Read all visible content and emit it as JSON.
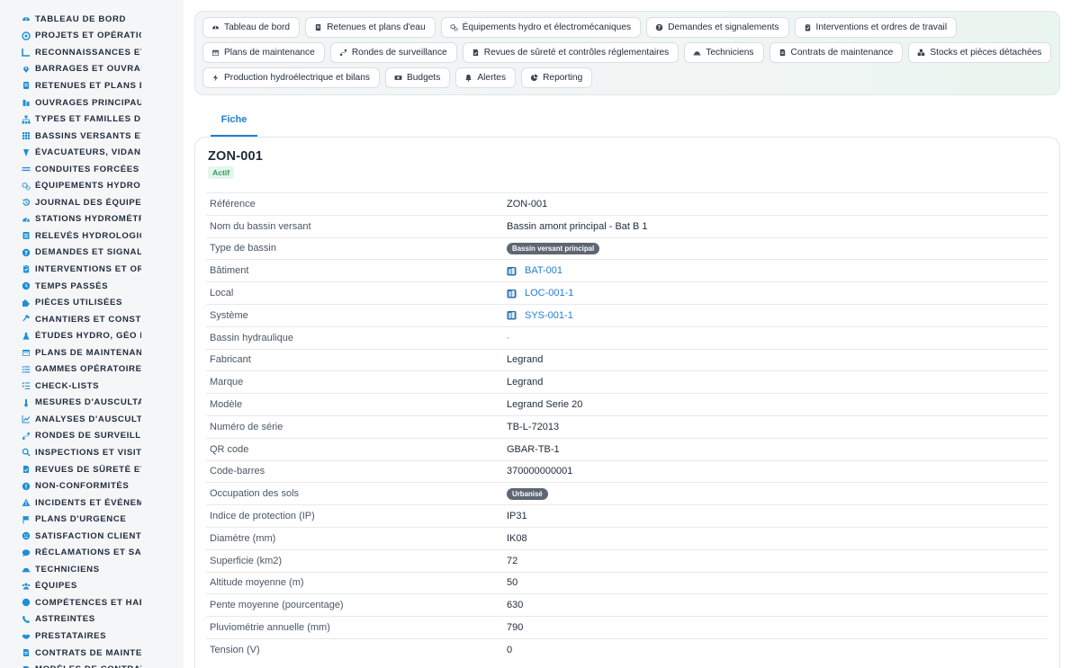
{
  "sidebar": {
    "items": [
      {
        "label": "TABLEAU DE BORD",
        "icon": "dashboard-icon"
      },
      {
        "label": "PROJETS ET OPÉRATION",
        "icon": "target-icon"
      },
      {
        "label": "RECONNAISSANCES ET V",
        "icon": "ruler-icon"
      },
      {
        "label": "BARRAGES ET OUVRAGE",
        "icon": "pin-icon"
      },
      {
        "label": "RETENUES ET PLANS D'E",
        "icon": "document-icon"
      },
      {
        "label": "OUVRAGES PRINCIPAUX",
        "icon": "building-icon"
      },
      {
        "label": "TYPES ET FAMILLES D'OU",
        "icon": "hierarchy-icon"
      },
      {
        "label": "BASSINS VERSANTS ET A",
        "icon": "grid-icon"
      },
      {
        "label": "ÉVACUATEURS, VIDANGE",
        "icon": "spillway-icon"
      },
      {
        "label": "CONDUITES FORCÉES ET",
        "icon": "pipe-icon"
      },
      {
        "label": "ÉQUIPEMENTS HYDRO ET",
        "icon": "cogs-icon"
      },
      {
        "label": "JOURNAL DES ÉQUIPEME",
        "icon": "history-icon"
      },
      {
        "label": "STATIONS HYDROMÉTRIC",
        "icon": "gauge-icon"
      },
      {
        "label": "RELEVÉS HYDROLOGIQU",
        "icon": "list-icon"
      },
      {
        "label": "DEMANDES ET SIGNALEM",
        "icon": "question-icon"
      },
      {
        "label": "INTERVENTIONS ET ORDI",
        "icon": "clipboard-icon"
      },
      {
        "label": "TEMPS PASSÉS",
        "icon": "clock-icon"
      },
      {
        "label": "PIÈCES UTILISÉES",
        "icon": "puzzle-icon"
      },
      {
        "label": "CHANTIERS ET CONSTRU",
        "icon": "hammer-icon"
      },
      {
        "label": "ÉTUDES HYDRO, GÉO ET",
        "icon": "flask-icon"
      },
      {
        "label": "PLANS DE MAINTENANCE",
        "icon": "calendar-icon"
      },
      {
        "label": "GAMMES OPÉRATOIRES",
        "icon": "bullet-list-icon"
      },
      {
        "label": "CHECK-LISTS",
        "icon": "checklist-icon"
      },
      {
        "label": "MESURES D'AUSCULTATI",
        "icon": "thermometer-icon"
      },
      {
        "label": "ANALYSES D'AUSCULTAT",
        "icon": "chart-line-icon"
      },
      {
        "label": "RONDES DE SURVEILLAN",
        "icon": "route-icon"
      },
      {
        "label": "INSPECTIONS ET VISITES",
        "icon": "search-icon"
      },
      {
        "label": "REVUES DE SÛRETÉ ET C",
        "icon": "file-check-icon"
      },
      {
        "label": "NON-CONFORMITÉS",
        "icon": "alert-circle-icon"
      },
      {
        "label": "INCIDENTS ET ÉVÉNEMEI",
        "icon": "warning-icon"
      },
      {
        "label": "PLANS D'URGENCE",
        "icon": "flag-icon"
      },
      {
        "label": "SATISFACTION CLIENT",
        "icon": "smile-icon"
      },
      {
        "label": "RÉCLAMATIONS ET SAV",
        "icon": "comment-icon"
      },
      {
        "label": "TECHNICIENS",
        "icon": "hardhat-icon"
      },
      {
        "label": "ÉQUIPES",
        "icon": "users-icon"
      },
      {
        "label": "COMPÉTENCES ET HABIL",
        "icon": "badge-icon"
      },
      {
        "label": "ASTREINTES",
        "icon": "phone-icon"
      },
      {
        "label": "PRESTATAIRES",
        "icon": "handshake-icon"
      },
      {
        "label": "CONTRATS DE MAINTENA",
        "icon": "contract-icon"
      },
      {
        "label": "MODÈLES DE CONTRATS",
        "icon": "file-icon"
      }
    ]
  },
  "nav": {
    "rows": [
      [
        {
          "label": "Tableau de bord",
          "icon": "dashboard-icon"
        },
        {
          "label": "Retenues et plans d'eau",
          "icon": "document-icon"
        },
        {
          "label": "Équipements hydro et électromécaniques",
          "icon": "cogs-icon"
        },
        {
          "label": "Demandes et signalements",
          "icon": "question-icon"
        },
        {
          "label": "Interventions et ordres de travail",
          "icon": "clipboard-icon"
        }
      ],
      [
        {
          "label": "Plans de maintenance",
          "icon": "calendar-icon"
        },
        {
          "label": "Rondes de surveillance",
          "icon": "route-icon"
        },
        {
          "label": "Revues de sûreté et contrôles réglementaires",
          "icon": "file-check-icon"
        },
        {
          "label": "Techniciens",
          "icon": "hardhat-icon"
        },
        {
          "label": "Contrats de maintenance",
          "icon": "contract-icon"
        },
        {
          "label": "Stocks et pièces détachées",
          "icon": "boxes-icon"
        }
      ],
      [
        {
          "label": "Production hydroélectrique et bilans",
          "icon": "bolt-icon"
        },
        {
          "label": "Budgets",
          "icon": "money-icon"
        },
        {
          "label": "Alertes",
          "icon": "bell-icon"
        },
        {
          "label": "Reporting",
          "icon": "pie-icon"
        }
      ]
    ]
  },
  "tab": {
    "label": "Fiche"
  },
  "record": {
    "title": "ZON-001",
    "status": "Actif",
    "fields": [
      {
        "key": "Référence",
        "value": "ZON-001",
        "kind": "text"
      },
      {
        "key": "Nom du bassin versant",
        "value": "Bassin amont principal - Bat B 1",
        "kind": "text"
      },
      {
        "key": "Type de bassin",
        "value": "Bassin versant principal",
        "kind": "badge"
      },
      {
        "key": "Bâtiment",
        "value": "BAT-001",
        "kind": "link"
      },
      {
        "key": "Local",
        "value": "LOC-001-1",
        "kind": "link"
      },
      {
        "key": "Système",
        "value": "SYS-001-1",
        "kind": "link"
      },
      {
        "key": "Bassin hydraulique",
        "value": "-",
        "kind": "empty"
      },
      {
        "key": "Fabricant",
        "value": "Legrand",
        "kind": "text"
      },
      {
        "key": "Marque",
        "value": "Legrand",
        "kind": "text"
      },
      {
        "key": "Modèle",
        "value": "Legrand Serie 20",
        "kind": "text"
      },
      {
        "key": "Numéro de série",
        "value": "TB-L-72013",
        "kind": "text"
      },
      {
        "key": "QR code",
        "value": "GBAR-TB-1",
        "kind": "text"
      },
      {
        "key": "Code-barres",
        "value": "370000000001",
        "kind": "text"
      },
      {
        "key": "Occupation des sols",
        "value": "Urbanisé",
        "kind": "badge"
      },
      {
        "key": "Indice de protection (IP)",
        "value": "IP31",
        "kind": "text"
      },
      {
        "key": "Diamètre (mm)",
        "value": "IK08",
        "kind": "text"
      },
      {
        "key": "Superficie (km2)",
        "value": "72",
        "kind": "text"
      },
      {
        "key": "Altitude moyenne (m)",
        "value": "50",
        "kind": "text"
      },
      {
        "key": "Pente moyenne (pourcentage)",
        "value": "630",
        "kind": "text"
      },
      {
        "key": "Pluviométrie annuelle (mm)",
        "value": "790",
        "kind": "text"
      },
      {
        "key": "Tension (V)",
        "value": "0",
        "kind": "text"
      }
    ]
  },
  "colors": {
    "accent": "#1f7fd1",
    "icon": "#1f8fd6",
    "badge": "#5d6773",
    "status_bg": "#e5f5ec",
    "status_text": "#2f9b5e"
  }
}
